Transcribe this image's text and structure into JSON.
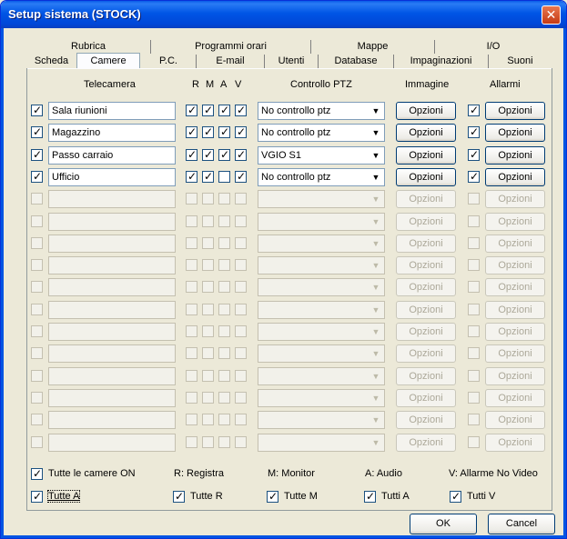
{
  "window": {
    "title": "Setup sistema (STOCK)"
  },
  "tabs_back": [
    "Rubrica",
    "Programmi orari",
    "Mappe",
    "I/O"
  ],
  "tabs_front": [
    "Scheda",
    "Camere",
    "P.C.",
    "E-mail",
    "Utenti",
    "Database",
    "Impaginazioni",
    "Suoni"
  ],
  "selected_tab": "Camere",
  "headers": {
    "telecamera": "Telecamera",
    "r": "R",
    "m": "M",
    "a": "A",
    "v": "V",
    "ptz": "Controllo PTZ",
    "immagine": "Immagine",
    "allarmi": "Allarmi"
  },
  "button_label": "Opzioni",
  "rows": [
    {
      "enabled": true,
      "name": "Sala riunioni",
      "r": true,
      "m": true,
      "a": true,
      "v": true,
      "ptz": "No controllo ptz",
      "alarm": true
    },
    {
      "enabled": true,
      "name": "Magazzino",
      "r": true,
      "m": true,
      "a": true,
      "v": true,
      "ptz": "No controllo ptz",
      "alarm": true
    },
    {
      "enabled": true,
      "name": "Passo carraio",
      "r": true,
      "m": true,
      "a": true,
      "v": true,
      "ptz": "VGIO S1",
      "alarm": true
    },
    {
      "enabled": true,
      "name": "Ufficio",
      "r": true,
      "m": true,
      "a": false,
      "v": true,
      "ptz": "No controllo ptz",
      "alarm": true
    },
    {
      "enabled": false
    },
    {
      "enabled": false
    },
    {
      "enabled": false
    },
    {
      "enabled": false
    },
    {
      "enabled": false
    },
    {
      "enabled": false
    },
    {
      "enabled": false
    },
    {
      "enabled": false
    },
    {
      "enabled": false
    },
    {
      "enabled": false
    },
    {
      "enabled": false
    },
    {
      "enabled": false
    }
  ],
  "footer": {
    "all_on": "Tutte le camere ON",
    "legend_r": "R: Registra",
    "legend_m": "M: Monitor",
    "legend_a": "A: Audio",
    "legend_v": "V: Allarme No Video",
    "all_a": "Tutte A",
    "all_r": "Tutte R",
    "all_m": "Tutte M",
    "all_a2": "Tutti A",
    "all_v": "Tutti V"
  },
  "dialog": {
    "ok": "OK",
    "cancel": "Cancel"
  },
  "colors": {
    "title_bar": "#0054e3",
    "check_mark": "#21a121",
    "close": "#c53a14"
  }
}
